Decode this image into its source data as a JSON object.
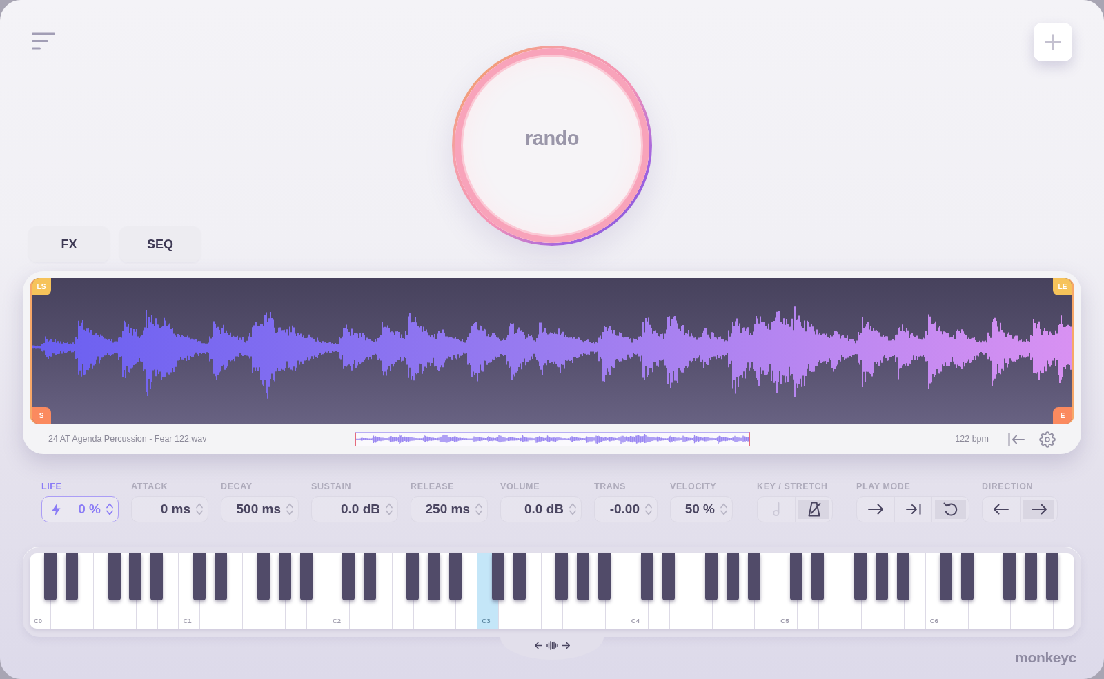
{
  "preset": {
    "name": "rando"
  },
  "tabs": [
    {
      "label": "FX",
      "selected": false
    },
    {
      "label": "SEQ",
      "selected": false
    }
  ],
  "sample": {
    "loop_markers": [
      {
        "label": "LS"
      },
      {
        "label": "LE"
      }
    ],
    "play_markers": [
      {
        "label": "S"
      },
      {
        "label": "E"
      }
    ],
    "filename": "24 AT Agenda Percussion - Fear 122.wav",
    "tempo": "122 bpm"
  },
  "params": [
    {
      "kind": "bolt",
      "label": "LIFE",
      "value": "0 %",
      "active": true
    },
    {
      "kind": "stepper",
      "label": "ATTACK",
      "value": "0 ms",
      "active": false
    },
    {
      "kind": "stepper",
      "label": "DECAY",
      "value": "500 ms",
      "active": false
    },
    {
      "kind": "stepper",
      "label": "SUSTAIN",
      "value": "0.0 dB",
      "active": false
    },
    {
      "kind": "stepper",
      "label": "RELEASE",
      "value": "250 ms",
      "active": false
    },
    {
      "kind": "stepper",
      "label": "VOLUME",
      "value": "0.0 dB",
      "active": false
    },
    {
      "kind": "stepper",
      "label": "TRANS",
      "value": "-0.00",
      "active": false
    },
    {
      "kind": "stepper",
      "label": "VELOCITY",
      "value": "50 %",
      "active": false
    },
    {
      "kind": "segmented",
      "label": "KEY / STRETCH",
      "options": [
        {
          "kind": "note",
          "selected": false,
          "disabled": true
        },
        {
          "kind": "metronome",
          "selected": true,
          "disabled": false
        }
      ]
    },
    {
      "kind": "segmented",
      "label": "PLAY MODE",
      "options": [
        {
          "kind": "forward",
          "selected": false,
          "disabled": false
        },
        {
          "kind": "once",
          "selected": false,
          "disabled": false
        },
        {
          "kind": "loop",
          "selected": true,
          "disabled": false
        }
      ]
    },
    {
      "kind": "segmented",
      "label": "DIRECTION",
      "options": [
        {
          "kind": "backward",
          "selected": false,
          "disabled": false
        },
        {
          "kind": "forward",
          "selected": true,
          "disabled": false
        }
      ]
    }
  ],
  "keyboard": {
    "c_keys": [
      {
        "label": "C0",
        "selected": false
      },
      {
        "label": "C1",
        "selected": false
      },
      {
        "label": "C2",
        "selected": false
      },
      {
        "label": "C3",
        "selected": true
      },
      {
        "label": "C4",
        "selected": false
      },
      {
        "label": "C5",
        "selected": false
      },
      {
        "label": "C6",
        "selected": false
      }
    ]
  },
  "brand": "monkeyc"
}
